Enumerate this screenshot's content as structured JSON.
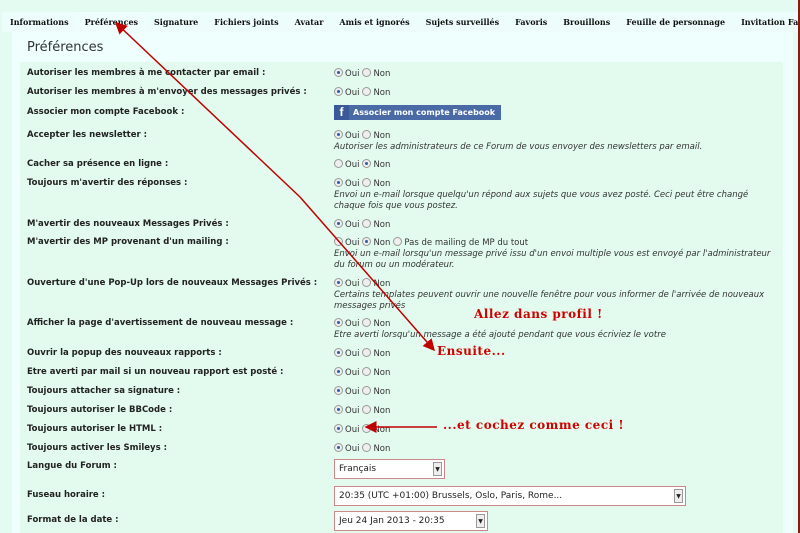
{
  "tabs": [
    "Informations",
    "Préférences",
    "Signature",
    "Fichiers joints",
    "Avatar",
    "Amis et ignorés",
    "Sujets surveillés",
    "Favoris",
    "Brouillons",
    "Feuille de personnage",
    "Invitation Facebook"
  ],
  "active_tab": "Préférences",
  "title": "Préférences",
  "yes": "Oui",
  "no": "Non",
  "rows": [
    {
      "label": "Autoriser les membres à me contacter par email :",
      "value": "Oui"
    },
    {
      "label": "Autoriser les membres à m'envoyer des messages privés :",
      "value": "Oui"
    },
    {
      "label": "Associer mon compte Facebook :",
      "button": "Associer mon compte Facebook"
    },
    {
      "label": "Accepter les newsletter :",
      "value": "Oui",
      "hint": "Autoriser les administrateurs de ce Forum de vous envoyer des newsletters par email."
    },
    {
      "label": "Cacher sa présence en ligne :",
      "value": "Non"
    },
    {
      "label": "Toujours m'avertir des réponses :",
      "value": "Oui",
      "hint": "Envoi un e-mail lorsque quelqu'un répond aux sujets que vous avez posté. Ceci peut être changé chaque fois que vous postez."
    },
    {
      "label": "M'avertir des nouveaux Messages Privés :",
      "value": "Oui"
    },
    {
      "label": "M'avertir des MP provenant d'un mailing :",
      "value": "Non",
      "extra": "Pas de mailing de MP du tout",
      "hint": "Envoi un e-mail lorsqu'un message privé issu d'un envoi multiple vous est envoyé par l'administrateur du forum ou un modérateur."
    },
    {
      "label": "Ouverture d'une Pop-Up lors de nouveaux Messages Privés :",
      "value": "Oui",
      "hint": "Certains templates peuvent ouvrir une nouvelle fenêtre pour vous informer de l'arrivée de nouveaux messages privés"
    },
    {
      "label": "Afficher la page d'avertissement de nouveau message :",
      "value": "Oui",
      "hint": "Etre averti lorsqu'un message a été ajouté pendant que vous écriviez le votre"
    },
    {
      "label": "Ouvrir la popup des nouveaux rapports :",
      "value": "Oui"
    },
    {
      "label": "Etre averti par mail si un nouveau rapport est posté :",
      "value": "Oui"
    },
    {
      "label": "Toujours attacher sa signature :",
      "value": "Oui"
    },
    {
      "label": "Toujours autoriser le BBCode :",
      "value": "Oui"
    },
    {
      "label": "Toujours autoriser le HTML :",
      "value": "Oui"
    },
    {
      "label": "Toujours activer les Smileys :",
      "value": "Oui"
    },
    {
      "label": "Langue du Forum :",
      "select": "Français"
    },
    {
      "label": "Fuseau horaire :",
      "select": "20:35 (UTC +01:00) Brussels, Oslo, Paris, Rome..."
    },
    {
      "label": "Format de la date :",
      "select": "Jeu 24 Jan 2013 - 20:35"
    }
  ],
  "annotations": [
    "Allez dans profil !",
    "Ensuite...",
    "...et cochez comme ceci !"
  ],
  "colors": {
    "annotation": "#d00000",
    "background": "#e4fbf2",
    "facebook": "#4a6aa5"
  }
}
